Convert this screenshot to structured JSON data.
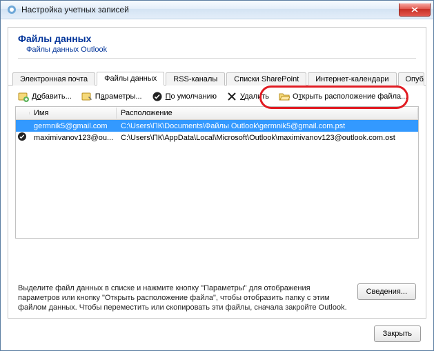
{
  "window": {
    "title": "Настройка учетных записей"
  },
  "header": {
    "title": "Файлы данных",
    "subtitle": "Файлы данных Outlook"
  },
  "tabs": {
    "t0": "Электронная почта",
    "t1": "Файлы данных",
    "t2": "RSS-каналы",
    "t3": "Списки SharePoint",
    "t4": "Интернет-календари",
    "t5": "Опубликован"
  },
  "toolbar": {
    "add": {
      "pre": "Д",
      "u": "о",
      "post": "бавить..."
    },
    "params": {
      "pre": "П",
      "u": "а",
      "post": "раметры..."
    },
    "default": {
      "pre": "",
      "u": "П",
      "post": "о умолчанию"
    },
    "delete": {
      "pre": "",
      "u": "У",
      "post": "далить"
    },
    "open": {
      "pre": "О",
      "u": "т",
      "post": "крыть расположение файла..."
    }
  },
  "columns": {
    "name": "Имя",
    "location": "Расположение"
  },
  "rows": [
    {
      "name": "germnik5@gmail.com",
      "location": "C:\\Users\\ПК\\Documents\\Файлы Outlook\\germnik5@gmail.com.pst",
      "selected": true,
      "default": false
    },
    {
      "name": "maximivanov123@ou...",
      "location": "C:\\Users\\ПК\\AppData\\Local\\Microsoft\\Outlook\\maximivanov123@outlook.com.ost",
      "selected": false,
      "default": true
    }
  ],
  "info": {
    "text": "Выделите файл данных в списке и нажмите кнопку \"Параметры\" для отображения параметров или кнопку \"Открыть расположение файла\", чтобы отобразить папку с этим файлом данных. Чтобы переместить или скопировать эти файлы, сначала закройте Outlook.",
    "details_btn": "Сведения..."
  },
  "footer": {
    "close": "Закрыть"
  },
  "colors": {
    "accent": "#3399ff",
    "highlight_ring": "#e11b22"
  }
}
